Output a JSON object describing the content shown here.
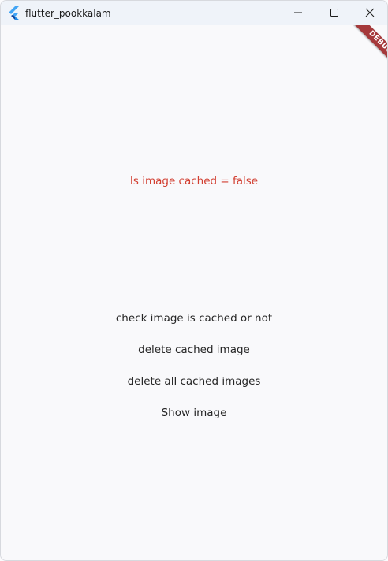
{
  "window": {
    "title": "flutter_pookkalam",
    "controls": {
      "minimize_icon": "minimize-icon",
      "maximize_icon": "maximize-icon",
      "close_icon": "close-icon"
    }
  },
  "main": {
    "status_text": "Is image cached = false",
    "status_color": "#d23f31",
    "buttons": [
      {
        "label": "check image is cached or not"
      },
      {
        "label": "delete cached image"
      },
      {
        "label": "delete all cached images"
      },
      {
        "label": "Show image"
      }
    ]
  },
  "debug_banner": {
    "label": "DEBUG",
    "color": "#a5393b"
  }
}
